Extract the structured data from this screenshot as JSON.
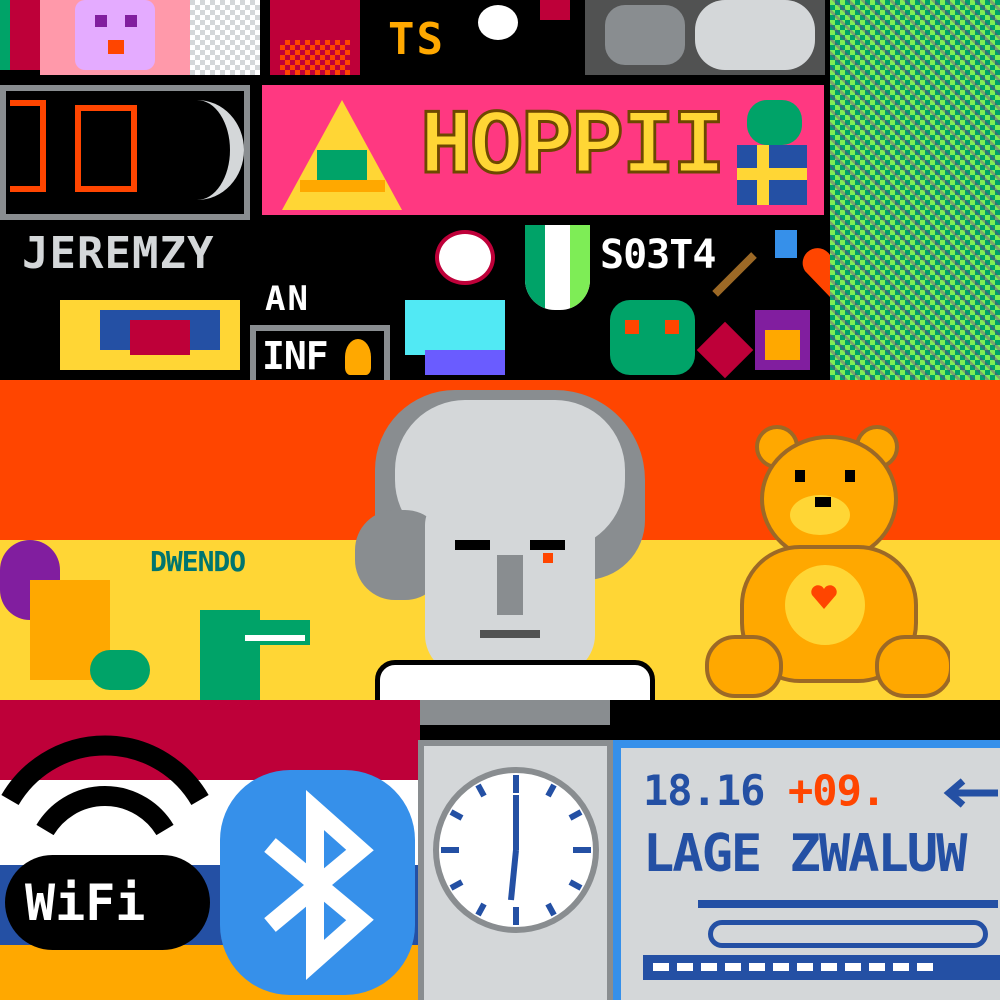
{
  "canvas": {
    "title": "",
    "colors": {
      "black": "#000000",
      "orange_red": "#ff4500",
      "yellow": "#ffd635",
      "gold": "#ffa800",
      "crimson": "#be0039",
      "white": "#ffffff",
      "gray": "#898d90",
      "light_gray": "#d4d7d9",
      "blue": "#3690ea",
      "dark_blue": "#2450a4",
      "pink": "#ff3881",
      "green": "#00a368",
      "dark_green": "#00756f",
      "purple": "#811e9f"
    }
  },
  "artworks": {
    "top_left_strip": {
      "text": "TS"
    },
    "hoppii_banner": {
      "text": "HOPPII"
    },
    "jeremzy_tag": {
      "text": "JEREMZY"
    },
    "s03t4_tag": {
      "text": "S03T4"
    },
    "an_tag": {
      "text": "AN"
    },
    "inf_tag": {
      "text": "INF"
    },
    "duende_tag": {
      "text": "DWENDO"
    },
    "wifi_logo": {
      "text": "WiFi",
      "icon": "wifi-icon"
    },
    "bluetooth_logo": {
      "icon": "bluetooth-icon"
    },
    "clock_widget": {
      "icon": "clock-icon"
    },
    "train_board": {
      "time_text": "18.16",
      "delay_text": "+09.",
      "station_text": "LAGE ZWALUW",
      "arrow_icon": "arrow-left-icon"
    },
    "beethoven_bust": {
      "icon": "beethoven-icon"
    },
    "teddy_bear": {
      "icon": "teddy-bear-icon"
    },
    "heart": {
      "icon": "heart-icon"
    }
  }
}
